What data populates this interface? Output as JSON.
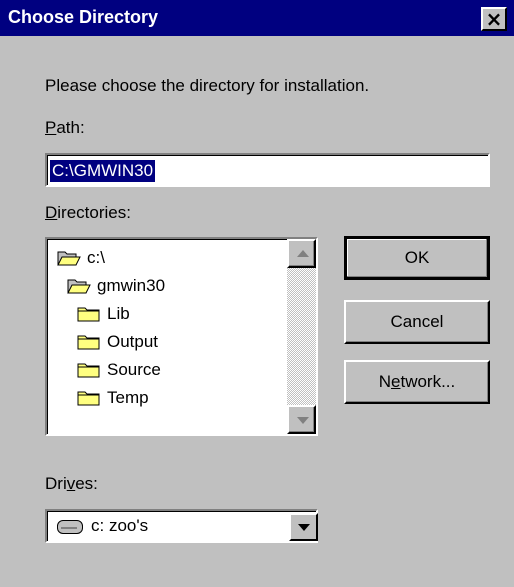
{
  "window": {
    "title": "Choose Directory",
    "close_label": "×"
  },
  "instructions": "Please choose the directory for installation.",
  "path": {
    "label_accel": "P",
    "label_rest": "ath:",
    "value": "C:\\GMWIN30"
  },
  "directories": {
    "label_accel": "D",
    "label_rest": "irectories:",
    "items": [
      {
        "label": "c:\\",
        "icon": "open-folder-icon"
      },
      {
        "label": "gmwin30",
        "icon": "open-folder-icon"
      },
      {
        "label": "Lib",
        "icon": "folder-icon"
      },
      {
        "label": "Output",
        "icon": "folder-icon"
      },
      {
        "label": "Source",
        "icon": "folder-icon"
      },
      {
        "label": "Temp",
        "icon": "folder-icon"
      }
    ]
  },
  "buttons": {
    "ok": "OK",
    "cancel": "Cancel",
    "network_pre": "N",
    "network_accel": "e",
    "network_rest": "twork..."
  },
  "drives": {
    "label_pre": "Dri",
    "label_accel": "v",
    "label_rest": "es:",
    "selected": "c: zoo's"
  },
  "colors": {
    "title_bar": "#000080",
    "face": "#c0c0c0",
    "selection": "#000080"
  }
}
